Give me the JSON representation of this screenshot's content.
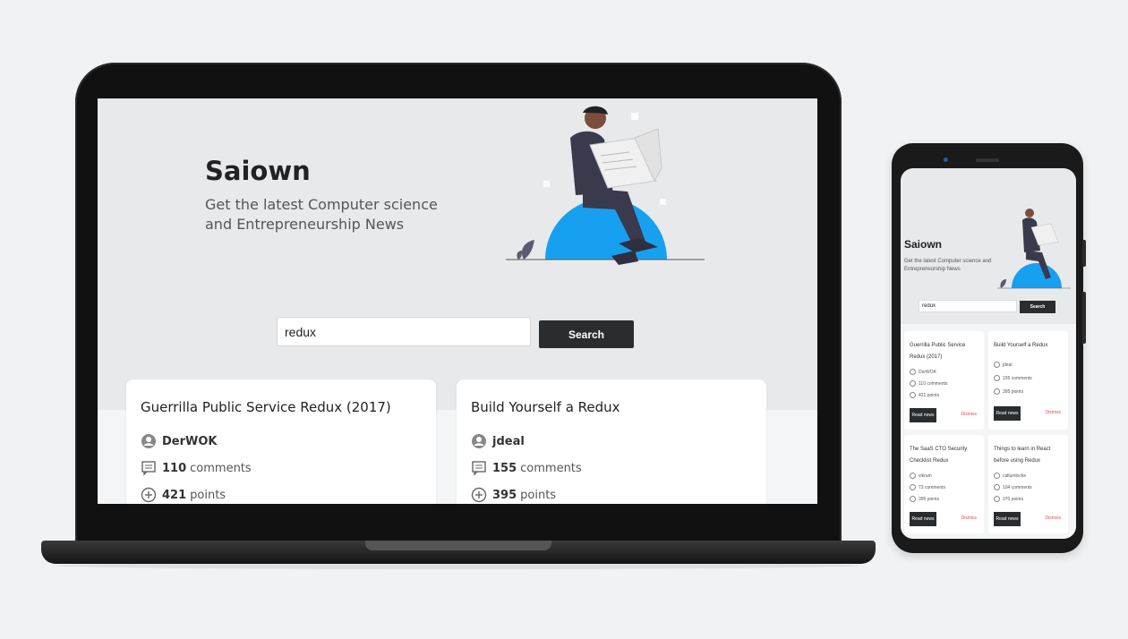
{
  "app": {
    "title": "Saiown",
    "subtitle": "Get the latest Computer science and Entrepreneurship News"
  },
  "search": {
    "value": "redux",
    "button_label": "Search"
  },
  "laptop_cards": [
    {
      "title": "Guerrilla Public Service Redux (2017)",
      "author": "DerWOK",
      "comments_count": "110",
      "comments_label": "comments",
      "points_count": "421",
      "points_label": "points"
    },
    {
      "title": "Build Yourself a Redux",
      "author": "jdeal",
      "comments_count": "155",
      "comments_label": "comments",
      "points_count": "395",
      "points_label": "points"
    }
  ],
  "phone": {
    "cards": [
      {
        "title": "Guerrilla Public Service Redux (2017)",
        "author": "DerWOK",
        "comments": "110 comments",
        "points": "421 points",
        "read_label": "Read news",
        "dismiss_label": "Dismiss"
      },
      {
        "title": "Build Yourself a Redux",
        "author": "jdeal",
        "comments": "155 comments",
        "points": "395 points",
        "read_label": "Read news",
        "dismiss_label": "Dismiss"
      },
      {
        "title": "The SaaS CTO Security Checklist Redux",
        "author": "vikrum",
        "comments": "73 comments",
        "points": "395 points",
        "read_label": "Read news",
        "dismiss_label": "Dismiss"
      },
      {
        "title": "Things to learn in React before using Redux",
        "author": "callumlocke",
        "comments": "104 comments",
        "points": "370 points",
        "read_label": "Read news",
        "dismiss_label": "Dismiss"
      }
    ]
  },
  "colors": {
    "accent_blue": "#18a0f0",
    "button_dark": "#2a2d30",
    "dismiss_red": "#e05050"
  }
}
